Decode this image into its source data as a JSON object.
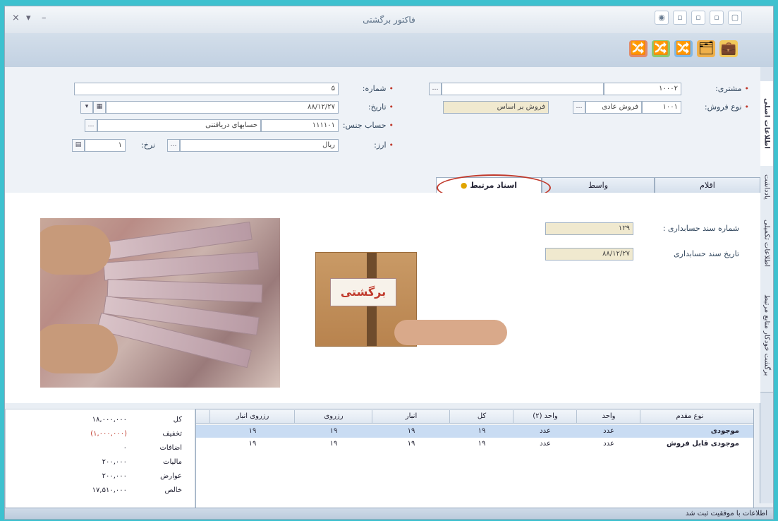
{
  "window": {
    "title": "فاکتور برگشتی",
    "controls": [
      "×",
      "▾",
      "–"
    ],
    "quick_access": [
      "◉",
      "▫",
      "▫",
      "▫",
      "▢"
    ]
  },
  "ribbon": {
    "tools": [
      "💼",
      "🗂",
      "🔀",
      "🔀",
      "🔀"
    ]
  },
  "vertical_tabs": [
    "اطلاعات اصلی",
    "یادداشت",
    "اطلاعات تکمیلی",
    "برگشت خودکار منابع مرتبط"
  ],
  "form": {
    "customer_label": "مشتری:",
    "customer_code": "۱۰۰۰۲",
    "sale_type_label": "نوع فروش:",
    "sale_type_code": "۱۰۰۱",
    "sale_type_name": "فروش عادی",
    "sale_type_extra": "فروش بر اساس",
    "number_label": "شماره:",
    "number_value": "۵",
    "date_label": "تاریخ:",
    "date_value": "۸۸/۱۲/۲۷",
    "account_label": "حساب جنس:",
    "account_code": "۱۱۱۱۰۱",
    "account_name": "حسابهای دریافتنی",
    "currency_label": "ارز:",
    "currency_value": "ریال",
    "rate_label": "نرخ:",
    "rate_value": "۱"
  },
  "tabs": [
    {
      "label": "اقلام",
      "active": false
    },
    {
      "label": "واسط",
      "active": false
    },
    {
      "label": "اسناد مرتبط",
      "active": true
    }
  ],
  "docs": {
    "voucher_no_label": "شماره سند حسابداری :",
    "voucher_no_value": "۱۲۹",
    "voucher_date_label": "تاریخ سند حسابداری",
    "voucher_date_value": "۸۸/۱۲/۲۷"
  },
  "box_text": "برگشتی",
  "grid": {
    "columns": [
      "نوع مقدم",
      "واحد",
      "واحد (۲)",
      "کل",
      "انبار",
      "رزروی",
      "رزروی انبار"
    ],
    "rows": [
      [
        "موجودی",
        "عدد",
        "عدد",
        "۱۹",
        "۱۹",
        "۱۹",
        "۱۹"
      ],
      [
        "موجودی قابل فروش",
        "عدد",
        "عدد",
        "۱۹",
        "۱۹",
        "۱۹",
        "۱۹"
      ]
    ]
  },
  "summary": [
    {
      "label": "کل",
      "value": "۱۸,۰۰۰,۰۰۰"
    },
    {
      "label": "تخفیف",
      "value": "(۱,۰۰۰,۰۰۰)"
    },
    {
      "label": "اضافات",
      "value": "۰"
    },
    {
      "label": "مالیات",
      "value": "۲۰۰,۰۰۰"
    },
    {
      "label": "عوارض",
      "value": "۲۰۰,۰۰۰"
    },
    {
      "label": "خالص",
      "value": "۱۷,۵۱۰,۰۰۰"
    }
  ],
  "status": "اطلاعات با موفقیت ثبت شد"
}
